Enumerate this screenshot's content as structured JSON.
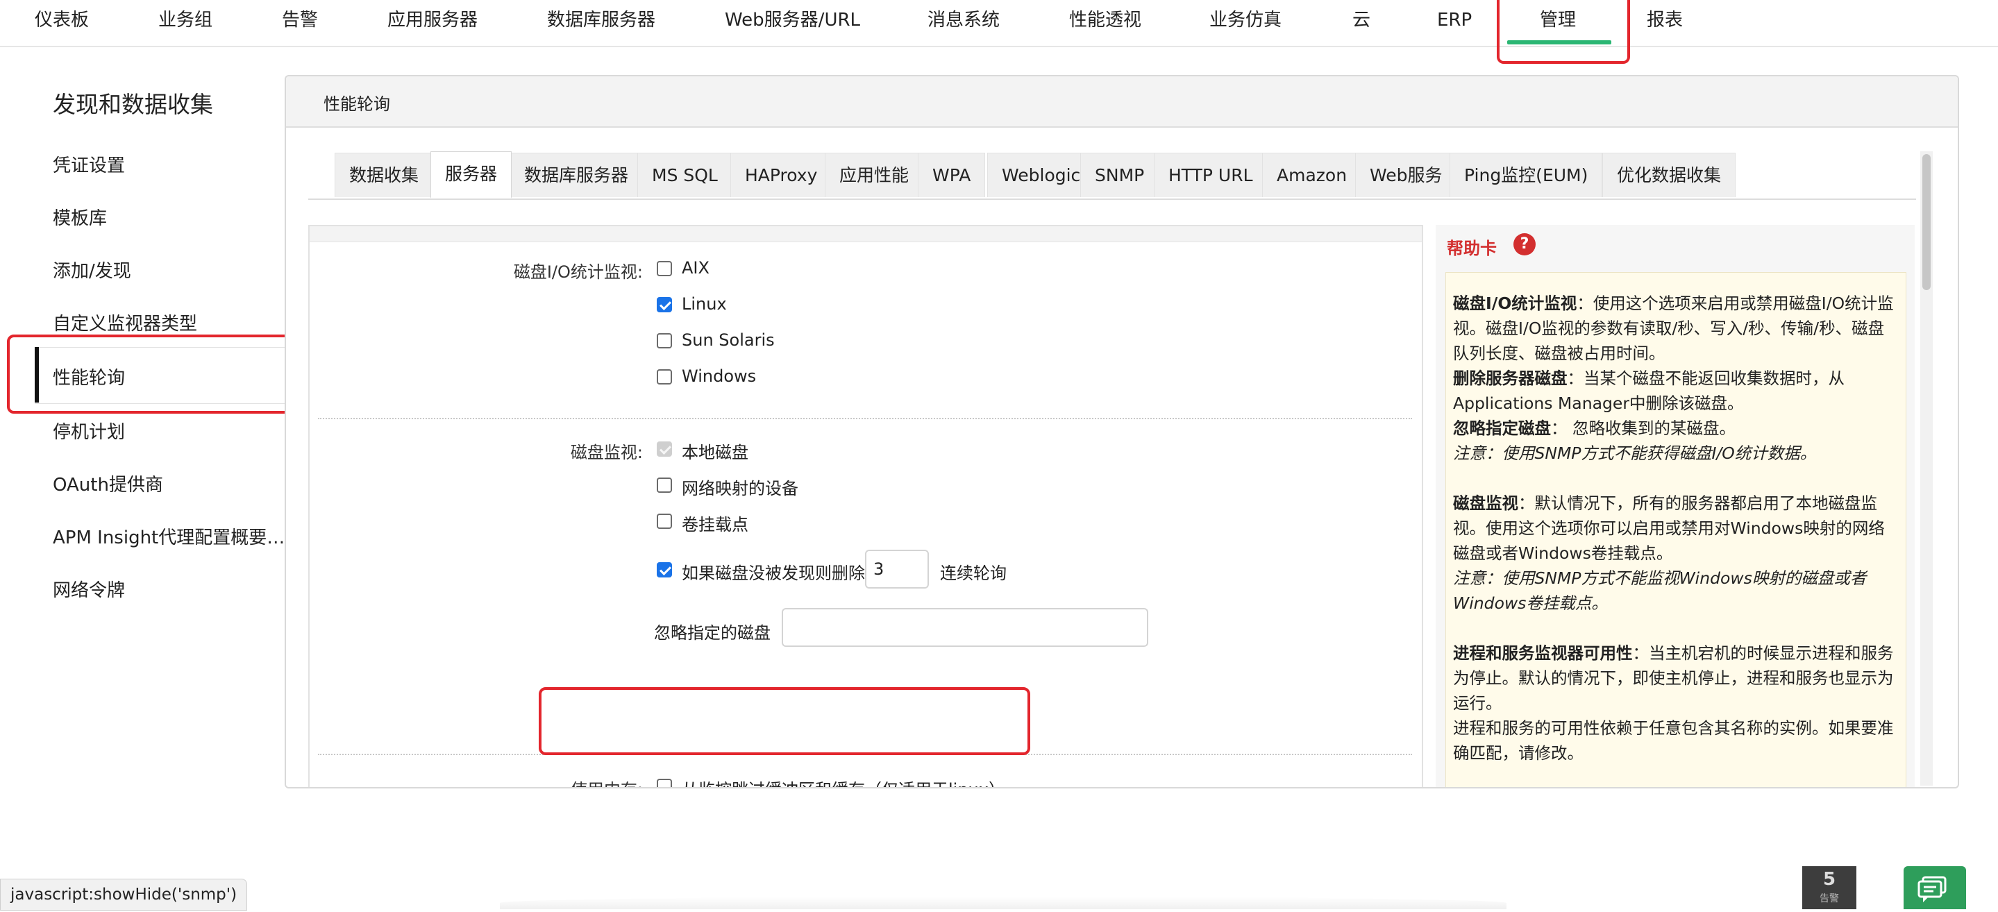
{
  "topnav": {
    "items": [
      "仪表板",
      "业务组",
      "告警",
      "应用服务器",
      "数据库服务器",
      "Web服务器/URL",
      "消息系统",
      "性能透视",
      "业务仿真",
      "云",
      "ERP",
      "管理",
      "报表"
    ],
    "active": "管理"
  },
  "sidebar": {
    "title": "发现和数据收集",
    "items": [
      "凭证设置",
      "模板库",
      "添加/发现",
      "自定义监视器类型",
      "性能轮询",
      "停机计划",
      "OAuth提供商",
      "APM Insight代理配置概要…",
      "网络令牌"
    ],
    "active": "性能轮询"
  },
  "panel": {
    "title": "性能轮询",
    "tabs": [
      "数据收集",
      "服务器",
      "数据库服务器",
      "MS SQL",
      "HAProxy",
      "应用性能",
      "WPA",
      "Weblogic",
      "SNMP",
      "HTTP URL",
      "Amazon",
      "Web服务",
      "Ping监控(EUM)",
      "优化数据收集"
    ],
    "active_tab": "服务器"
  },
  "form": {
    "disk_io": {
      "label": "磁盘I/O统计监视:",
      "options": [
        {
          "label": "AIX",
          "checked": false
        },
        {
          "label": "Linux",
          "checked": true
        },
        {
          "label": "Sun Solaris",
          "checked": false
        },
        {
          "label": "Windows",
          "checked": false
        }
      ]
    },
    "disk_monitor": {
      "label": "磁盘监视:",
      "options": [
        {
          "label": "本地磁盘",
          "checked": true,
          "disabled": true
        },
        {
          "label": "网络映射的设备",
          "checked": false
        },
        {
          "label": "卷挂载点",
          "checked": false
        }
      ],
      "delete_prefix": "如果磁盘没被发现则删除",
      "delete_checked": true,
      "delete_value": "3",
      "delete_suffix": "连续轮询",
      "ignore_label": "忽略指定的磁盘",
      "ignore_value": ""
    },
    "memory": {
      "label": "使用内存:",
      "option_label": "从监控跳过缓冲区和缓存（仅适用于linux）",
      "checked": false
    }
  },
  "help": {
    "title": "帮助卡",
    "icon": "?",
    "p1_bold": "磁盘I/O统计监视",
    "p1_text": "：使用这个选项来启用或禁用磁盘I/O统计监视。磁盘I/O监视的参数有读取/秒、写入/秒、传输/秒、磁盘队列长度、磁盘被占用时间。",
    "p2_bold": "删除服务器磁盘",
    "p2_text": "：当某个磁盘不能返回收集数据时，从Applications Manager中删除该磁盘。",
    "p3_bold": "忽略指定磁盘",
    "p3_text": "： 忽略收集到的某磁盘。",
    "p4_note": "注意：使用SNMP方式不能获得磁盘I/O统计数据。",
    "p5_bold": "磁盘监视",
    "p5_text": "：默认情况下，所有的服务器都启用了本地磁盘监视。使用这个选项你可以启用或禁用对Windows映射的网络磁盘或者Windows卷挂载点。",
    "p6_note": "注意：使用SNMP方式不能监视Windows映射的磁盘或者Windows卷挂载点。",
    "p7_bold": "进程和服务监视器可用性",
    "p7_text": "：当主机宕机的时候显示进程和服务为停止。默认的情况下，即使主机停止，进程和服务也显示为运行。",
    "p8_text": "进程和服务的可用性依赖于任意包含其名称的实例。如果要准确匹配，请修改。"
  },
  "statusbar": {
    "text": "javascript:showHide('snmp')"
  },
  "alarm_badge": {
    "count": "5",
    "label": "告警"
  },
  "colors": {
    "accent_green": "#2bb673",
    "highlight_red": "#e3262d",
    "checkbox_blue": "#1a73e8",
    "help_red": "#d32f2f"
  }
}
